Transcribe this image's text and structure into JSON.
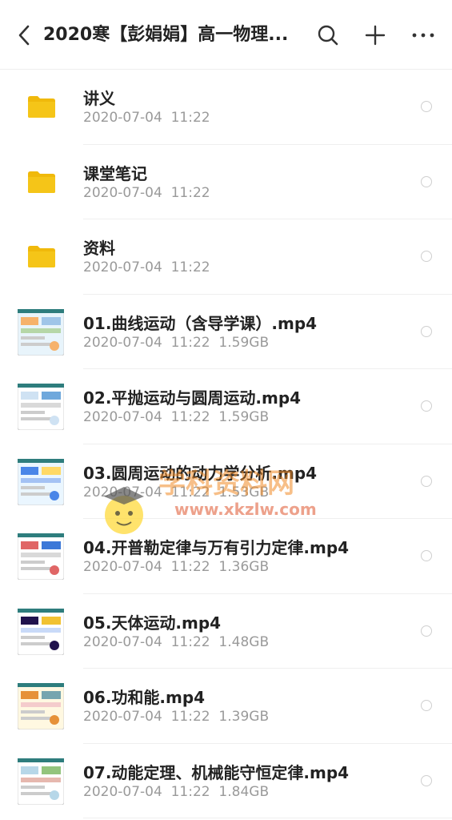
{
  "header": {
    "title": "2020寒【彭娟娟】高一物理...",
    "back_icon": "chevron-left-icon",
    "search_icon": "search-icon",
    "add_icon": "plus-icon",
    "more_icon": "more-horizontal-icon"
  },
  "colors": {
    "folder": "#f5c518",
    "folder_tab": "#f0b90b",
    "text": "#222222",
    "meta": "#9a9a9a"
  },
  "items": [
    {
      "type": "folder",
      "name": "讲义",
      "date": "2020-07-04  11:22",
      "size": ""
    },
    {
      "type": "folder",
      "name": "课堂笔记",
      "date": "2020-07-04  11:22",
      "size": ""
    },
    {
      "type": "folder",
      "name": "资料",
      "date": "2020-07-04  11:22",
      "size": ""
    },
    {
      "type": "video",
      "name": "01.曲线运动（含导学课）.mp4",
      "date": "2020-07-04  11:22",
      "size": "1.59GB"
    },
    {
      "type": "video",
      "name": "02.平抛运动与圆周运动.mp4",
      "date": "2020-07-04  11:22",
      "size": "1.59GB"
    },
    {
      "type": "video",
      "name": "03.圆周运动的动力学分析.mp4",
      "date": "2020-07-04  11:22",
      "size": "1.53GB"
    },
    {
      "type": "video",
      "name": "04.开普勒定律与万有引力定律.mp4",
      "date": "2020-07-04  11:22",
      "size": "1.36GB"
    },
    {
      "type": "video",
      "name": "05.天体运动.mp4",
      "date": "2020-07-04  11:22",
      "size": "1.48GB"
    },
    {
      "type": "video",
      "name": "06.功和能.mp4",
      "date": "2020-07-04  11:22",
      "size": "1.39GB"
    },
    {
      "type": "video",
      "name": "07.动能定理、机械能守恒定律.mp4",
      "date": "2020-07-04  11:22",
      "size": "1.84GB"
    }
  ],
  "watermark": {
    "text": "学科资料网",
    "url": "www.xkzlw.com"
  }
}
